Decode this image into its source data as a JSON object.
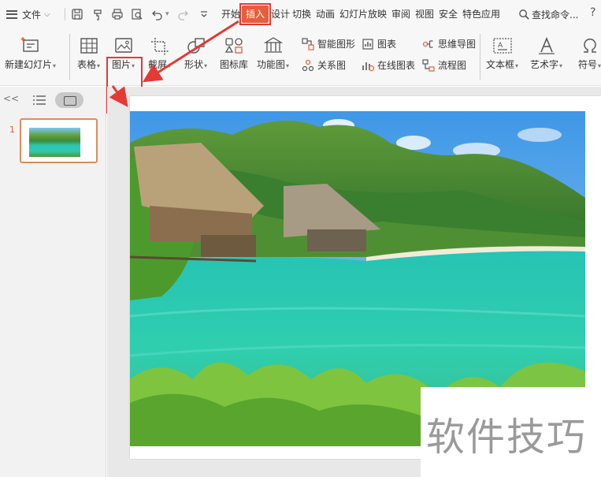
{
  "menubar": {
    "file_label": "文件",
    "tabs": [
      "开始",
      "插入",
      "设计",
      "切换",
      "动画",
      "幻灯片放映",
      "审阅",
      "视图",
      "安全",
      "特色应用"
    ],
    "active_tab": "插入",
    "search_label": "查找命令...",
    "help": "?"
  },
  "ribbon": {
    "new_slide": "新建幻灯片",
    "table": "表格",
    "picture": "图片",
    "screenshot": "截屏",
    "shape": "形状",
    "icon_library": "图标库",
    "function_chart": "功能图",
    "smart_shape": "智能图形",
    "chart": "图表",
    "mind_map": "思维导图",
    "relation_chart": "关系图",
    "online_chart": "在线图表",
    "flowchart": "流程图",
    "textbox": "文本框",
    "wordart": "艺术字",
    "symbol": "符号"
  },
  "left_panel": {
    "collapse": "<<",
    "slide_number": "1"
  },
  "watermark": "软件技巧",
  "colors": {
    "accent": "#e85d3a",
    "annotation_red": "#e53935"
  }
}
